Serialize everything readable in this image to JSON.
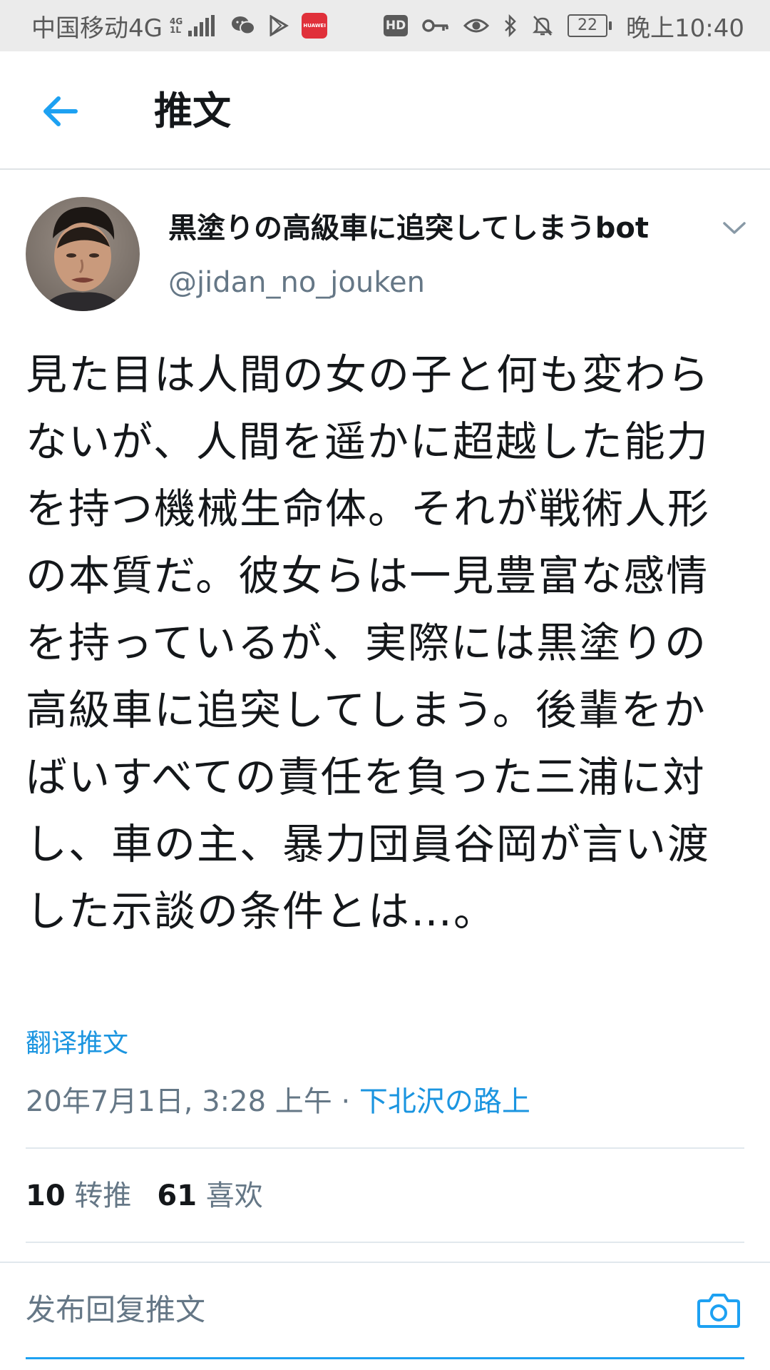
{
  "status_bar": {
    "carrier": "中国移动4G",
    "network_tag_top": "4G",
    "network_tag_bottom": "1L",
    "huawei_label": "HUAWEI",
    "hd_label": "HD",
    "battery": "22",
    "time": "晚上10:40",
    "icons": [
      "signal-icon",
      "wechat-icon",
      "play-store-icon",
      "huawei-appgallery-icon",
      "hd-icon",
      "key-icon",
      "eye-icon",
      "bluetooth-icon",
      "mute-bell-icon",
      "battery-icon"
    ]
  },
  "header": {
    "title": "推文",
    "back_icon": "back-arrow-icon"
  },
  "tweet": {
    "author_name": "黒塗りの高級車に追突してしまうbot",
    "author_handle": "@jidan_no_jouken",
    "text": "見た目は人間の女の子と何も変わらないが、人間を遥かに超越した能力を持つ機械生命体。それが戦術人形の本質だ。彼女らは一見豊富な感情を持っているが、実際には黒塗りの高級車に追突してしまう。後輩をかばいすべての責任を負った三浦に対し、車の主、暴力団員谷岡が言い渡した示談の条件とは…。",
    "translate_label": "翻译推文",
    "timestamp": "20年7月1日, 3:28 上午",
    "separator": " · ",
    "location": "下北沢の路上"
  },
  "stats": {
    "retweets_count": "10",
    "retweets_label": "转推",
    "likes_count": "61",
    "likes_label": "喜欢"
  },
  "reply": {
    "placeholder": "发布回复推文"
  },
  "colors": {
    "accent": "#1da1f2",
    "link": "#1b95e0",
    "secondary_text": "#657786",
    "status_bar_bg": "#ebebeb"
  }
}
